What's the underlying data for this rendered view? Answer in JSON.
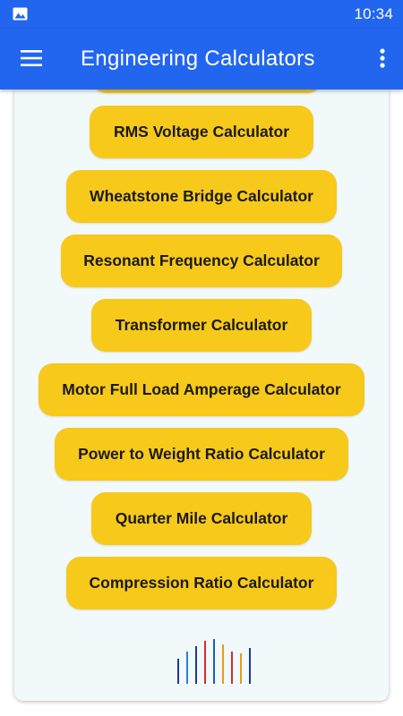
{
  "status_bar": {
    "time": "10:34",
    "icon": "image-icon"
  },
  "app_bar": {
    "title": "Engineering Calculators",
    "menu_icon": "hamburger-menu-icon",
    "overflow_icon": "more-vert-icon",
    "background_color": "#2266f0"
  },
  "calculators": [
    {
      "label": ""
    },
    {
      "label": "RMS Voltage Calculator"
    },
    {
      "label": "Wheatstone Bridge Calculator"
    },
    {
      "label": "Resonant Frequency Calculator"
    },
    {
      "label": "Transformer Calculator"
    },
    {
      "label": "Motor Full Load Amperage Calculator"
    },
    {
      "label": "Power to Weight Ratio Calculator"
    },
    {
      "label": "Quarter Mile Calculator"
    },
    {
      "label": "Compression Ratio Calculator"
    }
  ],
  "colors": {
    "button": "#f7c91a",
    "card_background": "#f1f9fb"
  },
  "footer": {
    "logo_icon": "bars-logo-icon"
  }
}
